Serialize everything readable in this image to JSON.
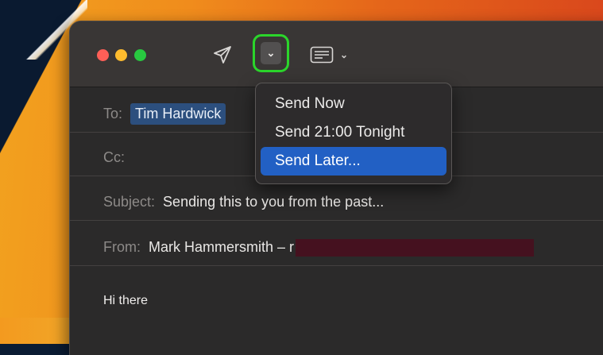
{
  "toolbar": {
    "send_icon": "paper-plane-icon",
    "dropdown_chevron": "⌄",
    "format_icon": "header-fields-icon",
    "format_chevron": "⌄"
  },
  "fields": {
    "to_label": "To:",
    "to_recipient": "Tim Hardwick",
    "cc_label": "Cc:",
    "subject_label": "Subject:",
    "subject_value": "Sending this to you from the past...",
    "from_label": "From:",
    "from_value": "Mark Hammersmith – r"
  },
  "body": {
    "text": "Hi there"
  },
  "send_menu": {
    "items": [
      {
        "label": "Send Now"
      },
      {
        "label": "Send 21:00 Tonight"
      },
      {
        "label": "Send Later...",
        "highlighted": true
      }
    ]
  },
  "colors": {
    "highlight_ring": "#2bd52b",
    "menu_selection": "#2260c4",
    "traffic_red": "#fe5f57",
    "traffic_yellow": "#febc2e",
    "traffic_green": "#28c840"
  }
}
